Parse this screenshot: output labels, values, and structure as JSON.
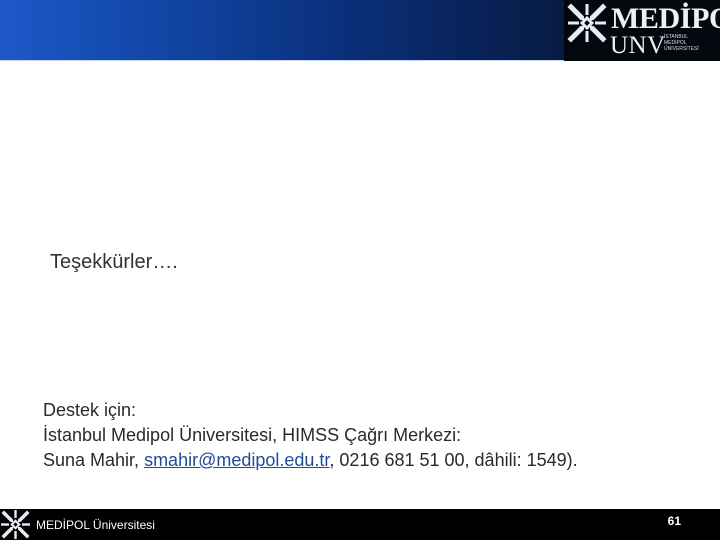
{
  "header": {
    "logo": {
      "brand_line": "MEDİPOL",
      "sub_line": "UNV",
      "small_lines": [
        "İSTANBUL",
        "MEDİPOL",
        "ÜNİVERSİTESİ"
      ],
      "mark_icon": "medipol-emblem-icon",
      "text_color": "#eef0f5"
    },
    "gradient_colors": [
      "#1e57c8",
      "#1248a9",
      "#0a2f7a",
      "#071b43",
      "#050d1e"
    ]
  },
  "main": {
    "thanks_text": "Teşekkürler….",
    "support": {
      "line1": "Destek için:",
      "line2": "İstanbul Medipol Üniversitesi, HIMSS Çağrı Merkezi:",
      "line3_prefix": "Suna Mahir, ",
      "email": "smahir@medipol.edu.tr",
      "line3_suffix": ", 0216 681 51 00, dâhili: 1549)."
    }
  },
  "footer": {
    "mark_icon": "medipol-emblem-icon",
    "institution": "MEDİPOL Üniversitesi",
    "page_number": "61"
  },
  "colors": {
    "page_background": "#ffffff",
    "body_text": "#2a2a2a",
    "thanks_text": "#333333",
    "link": "#1f4b9a",
    "footer_background": "#000000",
    "footer_text": "#ffffff"
  }
}
